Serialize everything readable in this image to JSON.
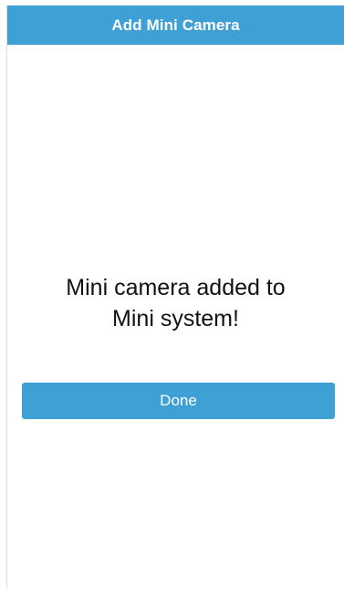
{
  "header": {
    "title": "Add Mini Camera"
  },
  "main": {
    "message_line1": "Mini camera added to",
    "message_line2": "Mini system!",
    "done_label": "Done"
  },
  "colors": {
    "accent": "#3fa0d6",
    "background": "#ffffff",
    "text": "#111111"
  }
}
